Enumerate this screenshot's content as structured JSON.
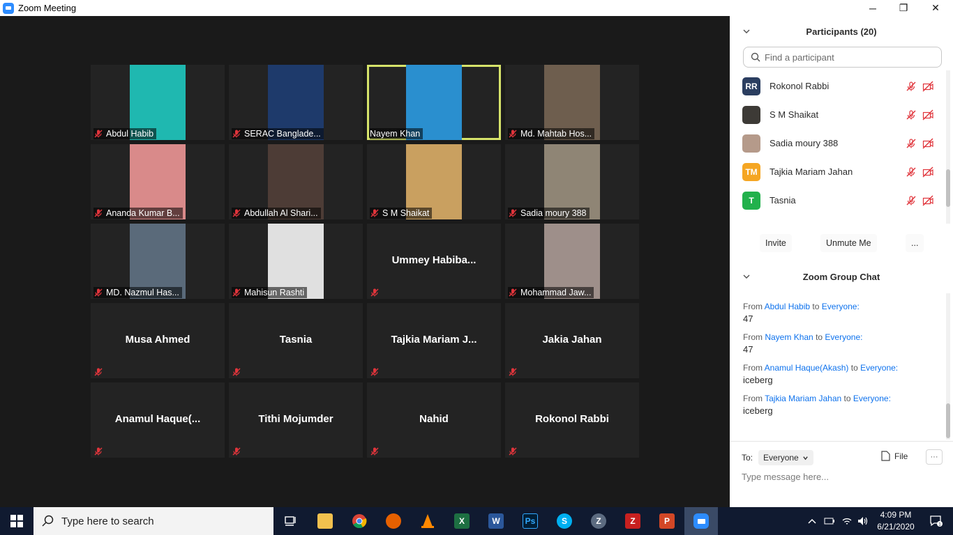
{
  "window": {
    "title": "Zoom Meeting",
    "controls": {
      "minimize": "─",
      "maximize": "❐",
      "close": "✕"
    }
  },
  "colors": {
    "accent": "#2d8cff",
    "active_speaker": "#d6e36a",
    "muted_red": "#e0343b",
    "link_blue": "#0e72ed"
  },
  "gallery": [
    {
      "name": "Abdul Habib",
      "video": true,
      "muted": true,
      "active": false
    },
    {
      "name": "SERAC Banglade...",
      "video": true,
      "muted": true,
      "active": false
    },
    {
      "name": "Nayem Khan",
      "video": true,
      "muted": false,
      "active": true
    },
    {
      "name": "Md. Mahtab Hos...",
      "video": true,
      "muted": true,
      "active": false
    },
    {
      "name": "Ananda Kumar B...",
      "video": true,
      "muted": true,
      "active": false
    },
    {
      "name": "Abdullah Al Shari...",
      "video": true,
      "muted": true,
      "active": false
    },
    {
      "name": "S M Shaikat",
      "video": true,
      "muted": true,
      "active": false
    },
    {
      "name": "Sadia moury 388",
      "video": true,
      "muted": true,
      "active": false
    },
    {
      "name": "MD. Nazmul Has...",
      "video": true,
      "muted": true,
      "active": false
    },
    {
      "name": "Mahisun Rashti",
      "video": true,
      "muted": true,
      "active": false
    },
    {
      "name": "Ummey  Habiba...",
      "video": false,
      "muted": true,
      "active": false
    },
    {
      "name": "Mohammad Jaw...",
      "video": true,
      "muted": true,
      "active": false
    },
    {
      "name": "Musa Ahmed",
      "video": false,
      "muted": true,
      "active": false
    },
    {
      "name": "Tasnia",
      "video": false,
      "muted": true,
      "active": false
    },
    {
      "name": "Tajkia  Mariam  J...",
      "video": false,
      "muted": true,
      "active": false
    },
    {
      "name": "Jakia Jahan",
      "video": false,
      "muted": true,
      "active": false
    },
    {
      "name": "Anamul  Haque(...",
      "video": false,
      "muted": true,
      "active": false
    },
    {
      "name": "Tithi Mojumder",
      "video": false,
      "muted": true,
      "active": false
    },
    {
      "name": "Nahid",
      "video": false,
      "muted": true,
      "active": false
    },
    {
      "name": "Rokonol Rabbi",
      "video": false,
      "muted": true,
      "active": false
    }
  ],
  "participants": {
    "title": "Participants (20)",
    "search_placeholder": "Find a participant",
    "list": [
      {
        "initials": "RR",
        "name": "Rokonol Rabbi",
        "avatar_color": "#2b3e60"
      },
      {
        "initials": "",
        "name": "S M Shaikat",
        "avatar_color": "#3d3a36"
      },
      {
        "initials": "",
        "name": "Sadia moury 388",
        "avatar_color": "#b59a8a"
      },
      {
        "initials": "TM",
        "name": "Tajkia Mariam Jahan",
        "avatar_color": "#f5a623"
      },
      {
        "initials": "T",
        "name": "Tasnia",
        "avatar_color": "#22b14c"
      }
    ],
    "buttons": {
      "invite": "Invite",
      "unmute": "Unmute Me",
      "more": "..."
    }
  },
  "chat": {
    "title": "Zoom Group Chat",
    "from_word": "From",
    "to_word": "to",
    "messages": [
      {
        "sender": "Abdul Habib",
        "recipient": "Everyone:",
        "text": "47"
      },
      {
        "sender": "Nayem Khan",
        "recipient": "Everyone:",
        "text": "47"
      },
      {
        "sender": "Anamul Haque(Akash)",
        "recipient": "Everyone:",
        "text": "iceberg"
      },
      {
        "sender": "Tajkia Mariam Jahan",
        "recipient": "Everyone:",
        "text": "iceberg"
      }
    ],
    "to_label": "To:",
    "to_value": "Everyone",
    "file_label": "File",
    "more_label": "···",
    "input_placeholder": "Type message here..."
  },
  "taskbar": {
    "search_placeholder": "Type here to search",
    "time": "4:09 PM",
    "date": "6/21/2020",
    "notification_count": "1"
  }
}
